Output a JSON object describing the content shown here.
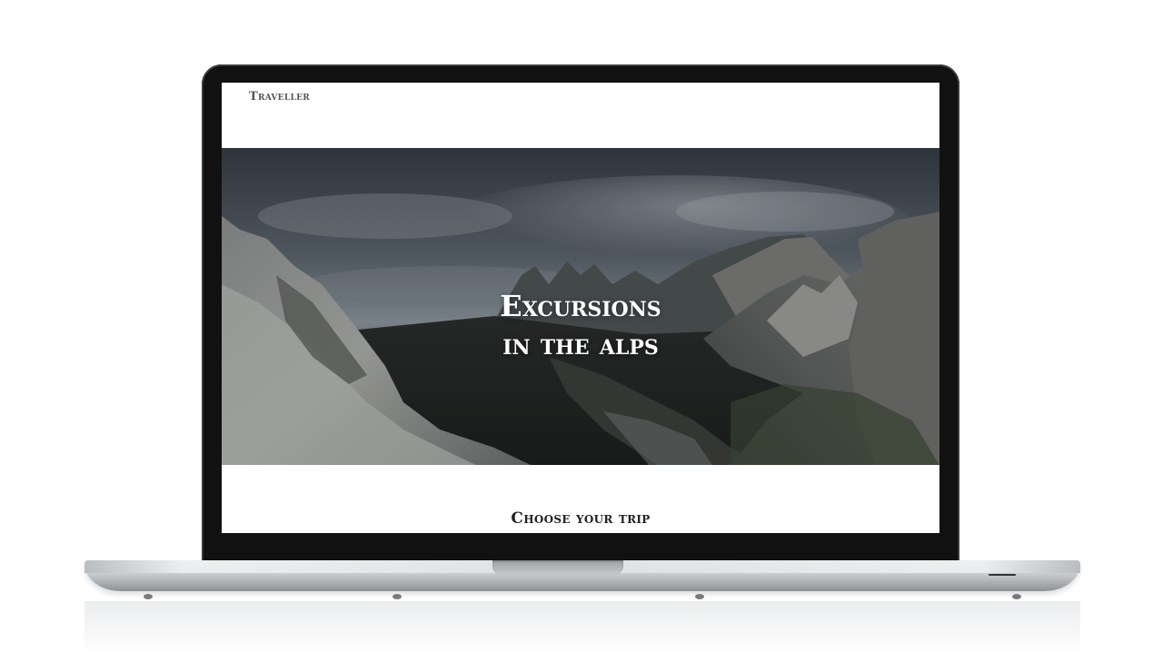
{
  "site": {
    "brand": "Traveller"
  },
  "hero": {
    "title_line1": "Excursions",
    "title_line2": "in the alps"
  },
  "section": {
    "heading": "Choose your trip"
  },
  "colors": {
    "bezel": "#111111",
    "hero_text": "#ffffff",
    "heading_text": "#222222",
    "brand_text": "#555555"
  },
  "icons": {
    "device": "laptop-frame"
  }
}
